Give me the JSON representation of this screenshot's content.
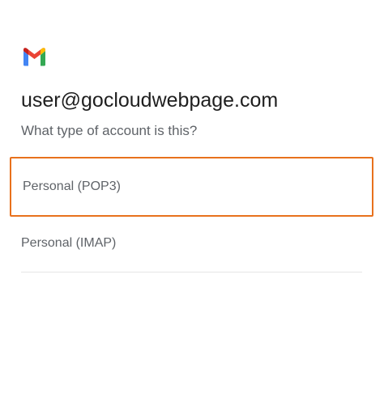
{
  "header": {
    "logo_icon": "gmail-logo-icon",
    "brand_colors": [
      "#4285F4",
      "#EA4335",
      "#FBBC04",
      "#34A853",
      "#C5221F"
    ]
  },
  "account": {
    "email": "user@gocloudwebpage.com"
  },
  "prompt": {
    "question": "What type of account is this?"
  },
  "options": [
    {
      "label": "Personal (POP3)",
      "selected": true
    },
    {
      "label": "Personal (IMAP)",
      "selected": false
    }
  ],
  "highlight_color": "#E8711C"
}
